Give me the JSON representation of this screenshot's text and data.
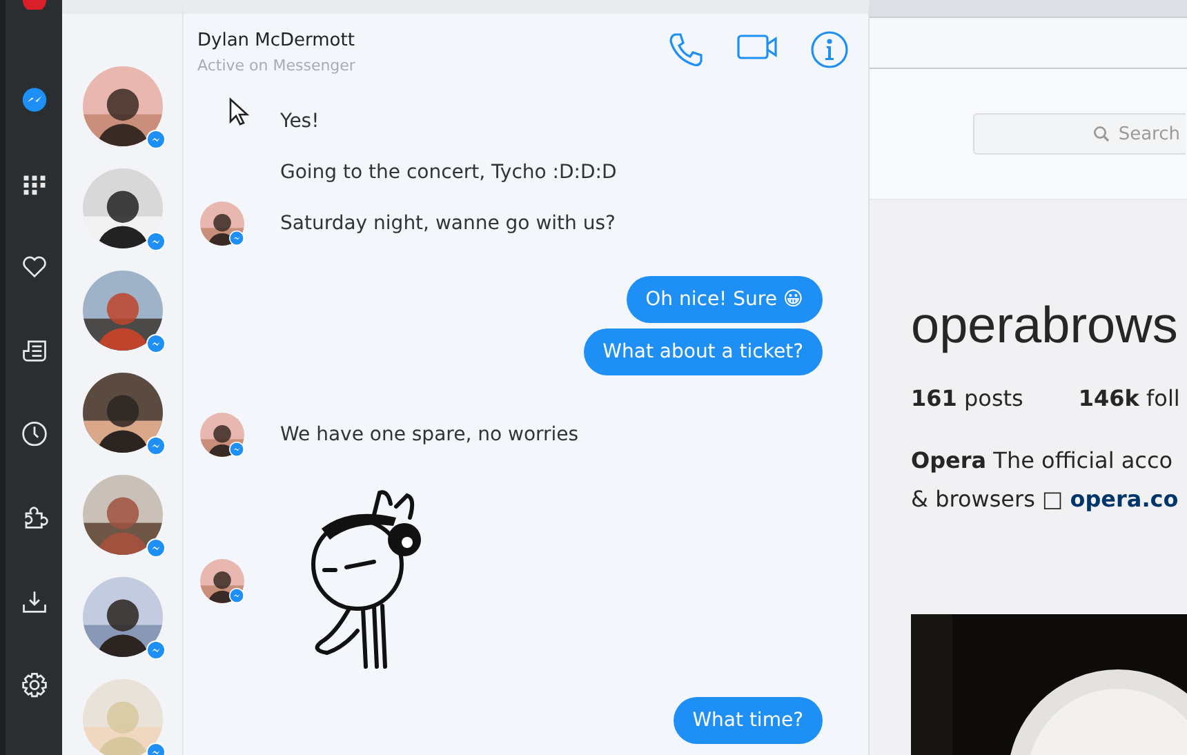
{
  "chat": {
    "contact_name": "Dylan McDermott",
    "contact_status": "Active on Messenger",
    "messages": [
      {
        "kind": "incoming",
        "text": "Yes!",
        "avatar": false
      },
      {
        "kind": "incoming",
        "text": "Going to the concert, Tycho :D:D:D",
        "avatar": false
      },
      {
        "kind": "incoming",
        "text": "Saturday night, wanne go with us?",
        "avatar": true
      },
      {
        "kind": "outgoing",
        "text": "Oh nice! Sure 😀"
      },
      {
        "kind": "outgoing",
        "text": "What about a ticket?"
      },
      {
        "kind": "incoming",
        "text": "We have one spare, no worries",
        "avatar": true
      },
      {
        "kind": "sticker",
        "avatar": true
      },
      {
        "kind": "outgoing",
        "text": "What time?"
      }
    ]
  },
  "web_page": {
    "search": {
      "placeholder": "Search"
    },
    "username": "operabrows",
    "stats": [
      {
        "count": "161",
        "label": "posts"
      },
      {
        "count": "146k",
        "label": "foll"
      }
    ],
    "bio": {
      "name": "Opera",
      "text": "The official acco",
      "line_2": "& browsers □",
      "link": "opera.co"
    }
  }
}
